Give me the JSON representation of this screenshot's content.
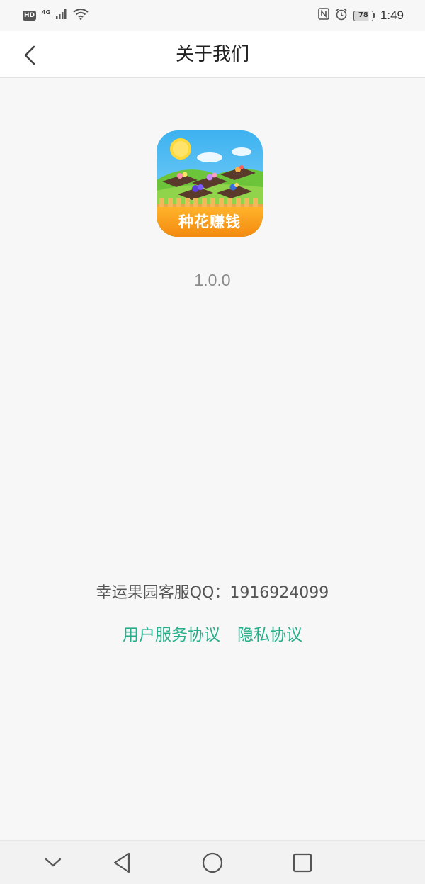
{
  "status_bar": {
    "hd_label": "HD",
    "network": "4G",
    "signal_icon": "signal-bars-icon",
    "wifi_icon": "wifi-icon",
    "nfc_icon": "nfc-icon",
    "alarm_icon": "alarm-clock-icon",
    "battery": "78",
    "time": "1:49"
  },
  "header": {
    "back_icon": "chevron-left-icon",
    "title": "关于我们"
  },
  "app": {
    "icon_label": "种花赚钱",
    "version": "1.0.0"
  },
  "footer": {
    "contact": "幸运果园客服QQ：1916924099",
    "terms_link": "用户服务协议",
    "privacy_link": "隐私协议",
    "link_color": "#27ae8a"
  },
  "nav_bar": {
    "items": [
      "chevron-down-icon",
      "back-triangle-icon",
      "home-circle-icon",
      "recents-square-icon"
    ]
  }
}
